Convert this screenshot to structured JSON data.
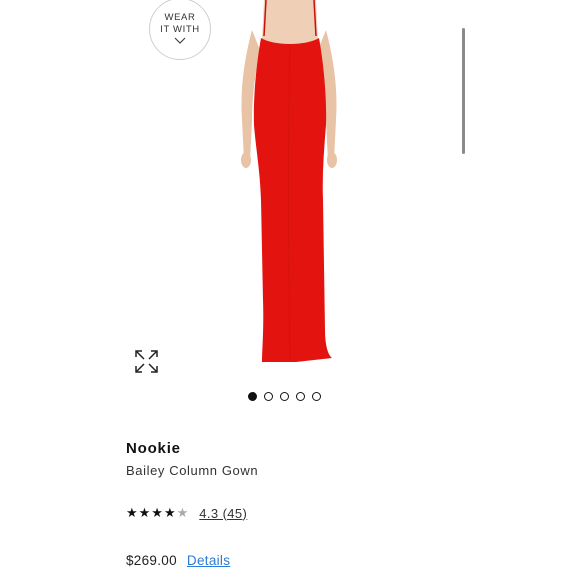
{
  "wear_button": {
    "line1": "WEAR",
    "line2": "IT WITH",
    "icon": "chevron-down-icon"
  },
  "gallery": {
    "dot_count": 5,
    "active_index": 0,
    "expand_icon": "expand-icon"
  },
  "product": {
    "brand": "Nookie",
    "name": "Bailey Column Gown",
    "rating_stars": "★★★★",
    "rating_half": "★",
    "rating_value": 4.3,
    "rating_text": "4.3 (45)",
    "price": "$269.00",
    "details_label": "Details",
    "dress_color": "#e3140f"
  },
  "colors": {
    "link": "#2b7bd6",
    "accent_dress": "#e3140f"
  }
}
